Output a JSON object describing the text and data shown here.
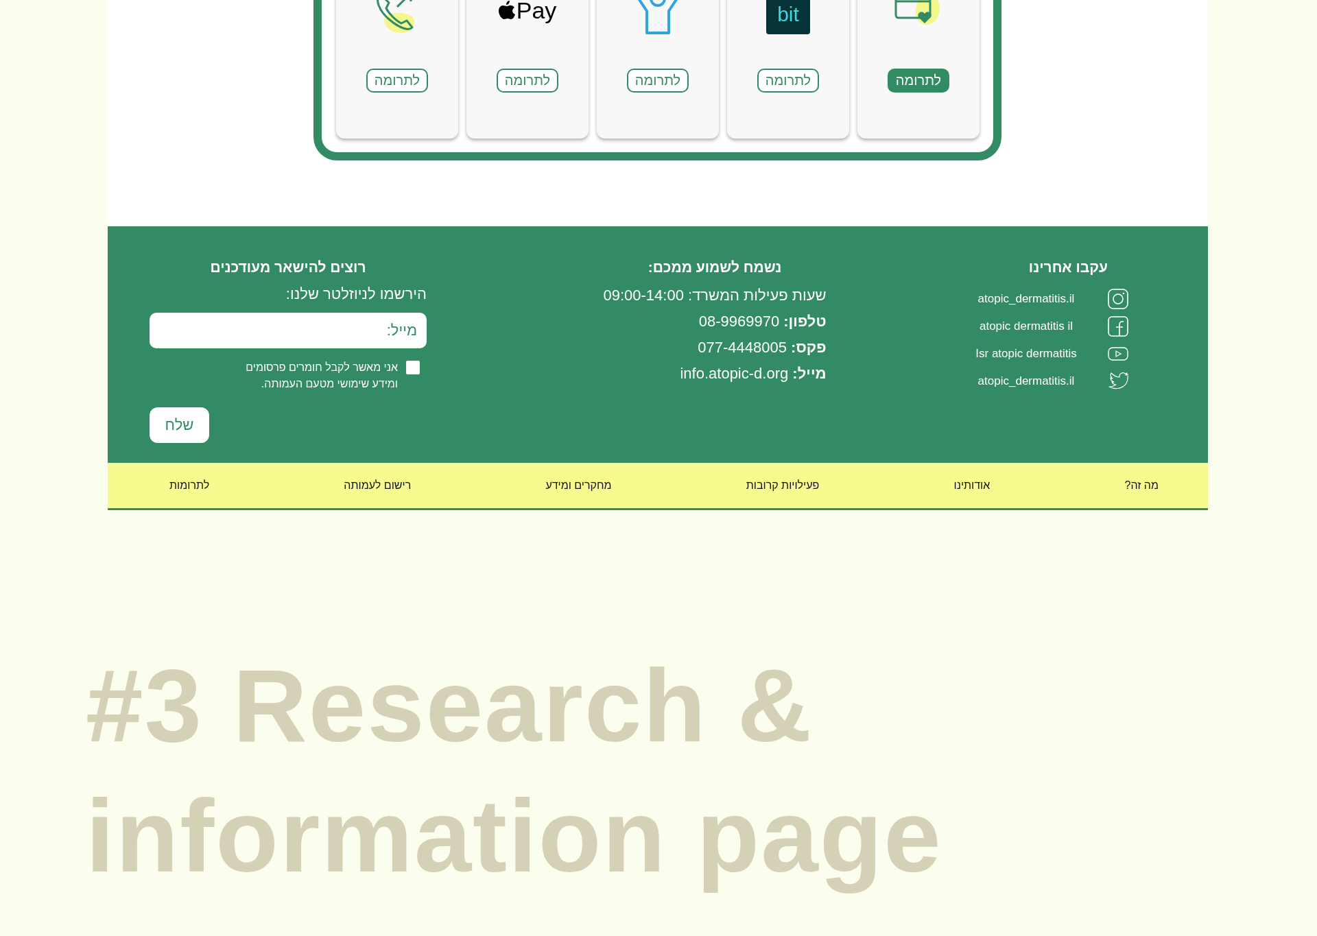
{
  "donation_cards": [
    {
      "kind": "card-heart",
      "button": "לתרומה",
      "selected": true
    },
    {
      "kind": "bit",
      "logo": "bit",
      "button": "לתרומה",
      "selected": false
    },
    {
      "kind": "person",
      "button": "לתרומה",
      "selected": false
    },
    {
      "kind": "applepay",
      "logo": "Pay",
      "button": "לתרומה",
      "selected": false
    },
    {
      "kind": "phone",
      "button": "לתרומה",
      "selected": false
    }
  ],
  "footer": {
    "follow": {
      "heading": "עקבו אחרינו",
      "items": [
        {
          "kind": "instagram",
          "label": "atopic_dermatitis.il"
        },
        {
          "kind": "facebook",
          "label": "atopic dermatitis il"
        },
        {
          "kind": "youtube",
          "label": "Isr atopic dermatitis"
        },
        {
          "kind": "twitter",
          "label": "atopic_dermatitis.il"
        }
      ]
    },
    "contact": {
      "heading": "נשמח לשמוע ממכם:",
      "lines": [
        "שעות פעילות המשרד: 09:00-14:00",
        "**טלפון:** 08-9969970",
        "**פקס:** 077-4448005",
        "**מייל:** info.atopic-d.org"
      ]
    },
    "newsletter": {
      "heading": "רוצים להישאר מעודכנים",
      "subtitle": "הירשמו לניוזלטר שלנו:",
      "email": {
        "placeholder": "מייל:"
      },
      "consent": {
        "text": "אני מאשר לקבל חומרים פרסומים ומידע שימושי מטעם העמותה.",
        "checked": false
      },
      "button": "שלח"
    }
  },
  "nav": {
    "items": [
      "מה זה?",
      "אודותינו",
      "פעילויות קרובות",
      "מחקרים ומידע",
      "רישום לעמותה",
      "לתרומות"
    ]
  },
  "hero": {
    "lines": [
      "#3 Research &",
      "information page"
    ]
  }
}
